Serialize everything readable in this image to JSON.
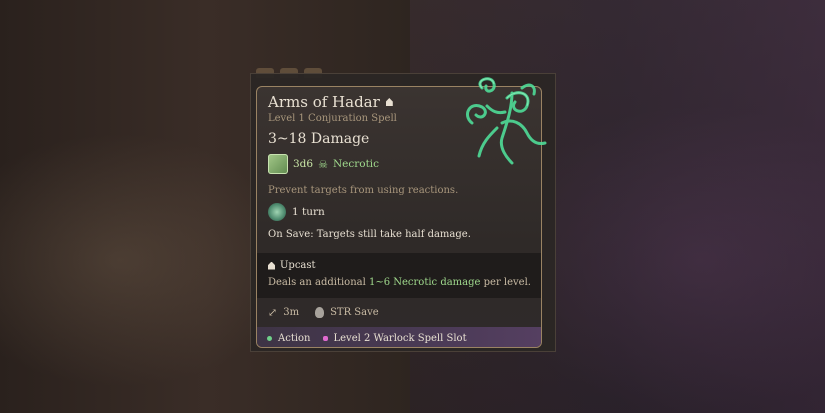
{
  "spell": {
    "name": "Arms of Hadar",
    "subtitle": "Level 1 Conjuration Spell",
    "damage": "3~18 Damage",
    "dice": "3d6",
    "damage_type": "Necrotic",
    "description": "Prevent targets from using reactions.",
    "duration": "1 turn",
    "on_save": "On Save: Targets still take half damage."
  },
  "upcast": {
    "title": "Upcast",
    "prefix": "Deals an additional ",
    "highlight": "1~6 Necrotic damage",
    "suffix": " per level."
  },
  "stats": {
    "range": "3m",
    "save": "STR Save"
  },
  "cost": {
    "action": "Action",
    "slot": "Level 2 Warlock Spell Slot"
  },
  "colors": {
    "necrotic": "#9fd88c",
    "accent_border": "#9a8363",
    "spell_art": "#4fdc98"
  },
  "icons": {
    "upcast": "upcast-icon",
    "dice": "necrotic-dice-icon",
    "duration": "turn-icon",
    "range": "range-icon",
    "save": "strength-save-icon",
    "art": "arms-of-hadar-spell-art"
  }
}
